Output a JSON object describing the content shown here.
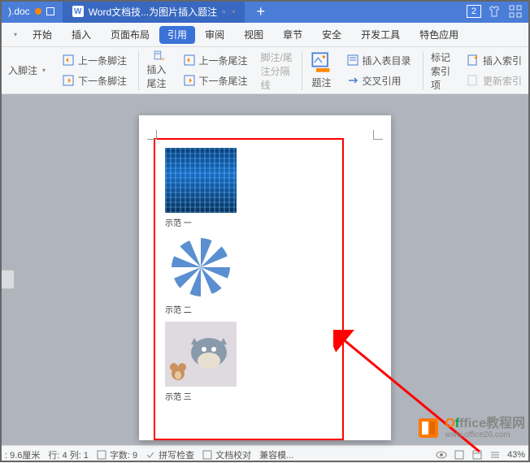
{
  "titlebar": {
    "doc_tab": ").doc",
    "active_tab": "Word文档技...为图片插入题注",
    "count": "2"
  },
  "menu": {
    "start": "开始",
    "insert": "插入",
    "layout": "页面布局",
    "reference": "引用",
    "review": "审阅",
    "view": "视图",
    "chapter": "章节",
    "security": "安全",
    "devtools": "开发工具",
    "special": "特色应用"
  },
  "ribbon": {
    "prev_footnote": "上一条脚注",
    "next_footnote": "下一条脚注",
    "insert_footnote": "入脚注",
    "insert_endnote": "插入尾注",
    "prev_endnote": "上一条尾注",
    "next_endnote": "下一条尾注",
    "separator": "脚注/尾注分隔线",
    "caption": "题注",
    "insert_toc": "插入表目录",
    "crossref": "交叉引用",
    "mark_index": "标记索引项",
    "insert_index": "插入索引",
    "update_index": "更新索引"
  },
  "captions": {
    "c1": "示范 一",
    "c2": "示范 二",
    "c3": "示范 三"
  },
  "status": {
    "pos_y": ": 9.6厘米",
    "row_col": "行: 4  列: 1",
    "wordcount": "字数: 9",
    "spellcheck": "拼写检查",
    "doccheck": "文档校对",
    "compat": "兼容模...",
    "zoom": "43%"
  },
  "watermark": {
    "title_rest": "ffice教程网",
    "url": "www.office26.com"
  }
}
